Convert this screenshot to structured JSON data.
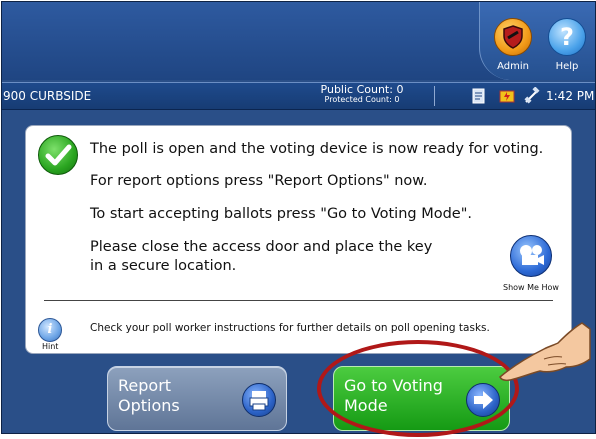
{
  "header": {
    "admin_label": "Admin",
    "help_label": "Help",
    "admin_icon": "shield-icon",
    "help_icon": "question-mark-icon",
    "help_glyph": "?"
  },
  "status_bar": {
    "poll_name": "900 CURBSIDE",
    "public_count": "Public Count: 0",
    "protected_count": "Protected Count: 0",
    "icons": [
      "document-icon",
      "battery-charging-icon",
      "satellite-icon"
    ],
    "time": "1:42 PM"
  },
  "message": {
    "line1": "The poll is open and the voting device is now ready for voting.",
    "line2": "For report options press \"Report Options\" now.",
    "line3": "To start accepting ballots press \"Go to Voting Mode\".",
    "line4a": "Please close the access door and place the key",
    "line4b": "in a secure location.",
    "show_me_how": "Show Me How",
    "hint_glyph": "i",
    "hint_label": "Hint",
    "hint_text": "Check your poll worker instructions for further details on poll opening tasks."
  },
  "buttons": {
    "report_line1": "Report",
    "report_line2": "Options",
    "voting_line1": "Go to Voting",
    "voting_line2": "Mode"
  },
  "colors": {
    "background_blue": "#2a4f88",
    "voting_green": "#2bb02a",
    "report_gray": "#7489a8",
    "highlight_red": "#b01818",
    "admin_orange": "#f29a18",
    "help_blue": "#4aa2ea"
  }
}
